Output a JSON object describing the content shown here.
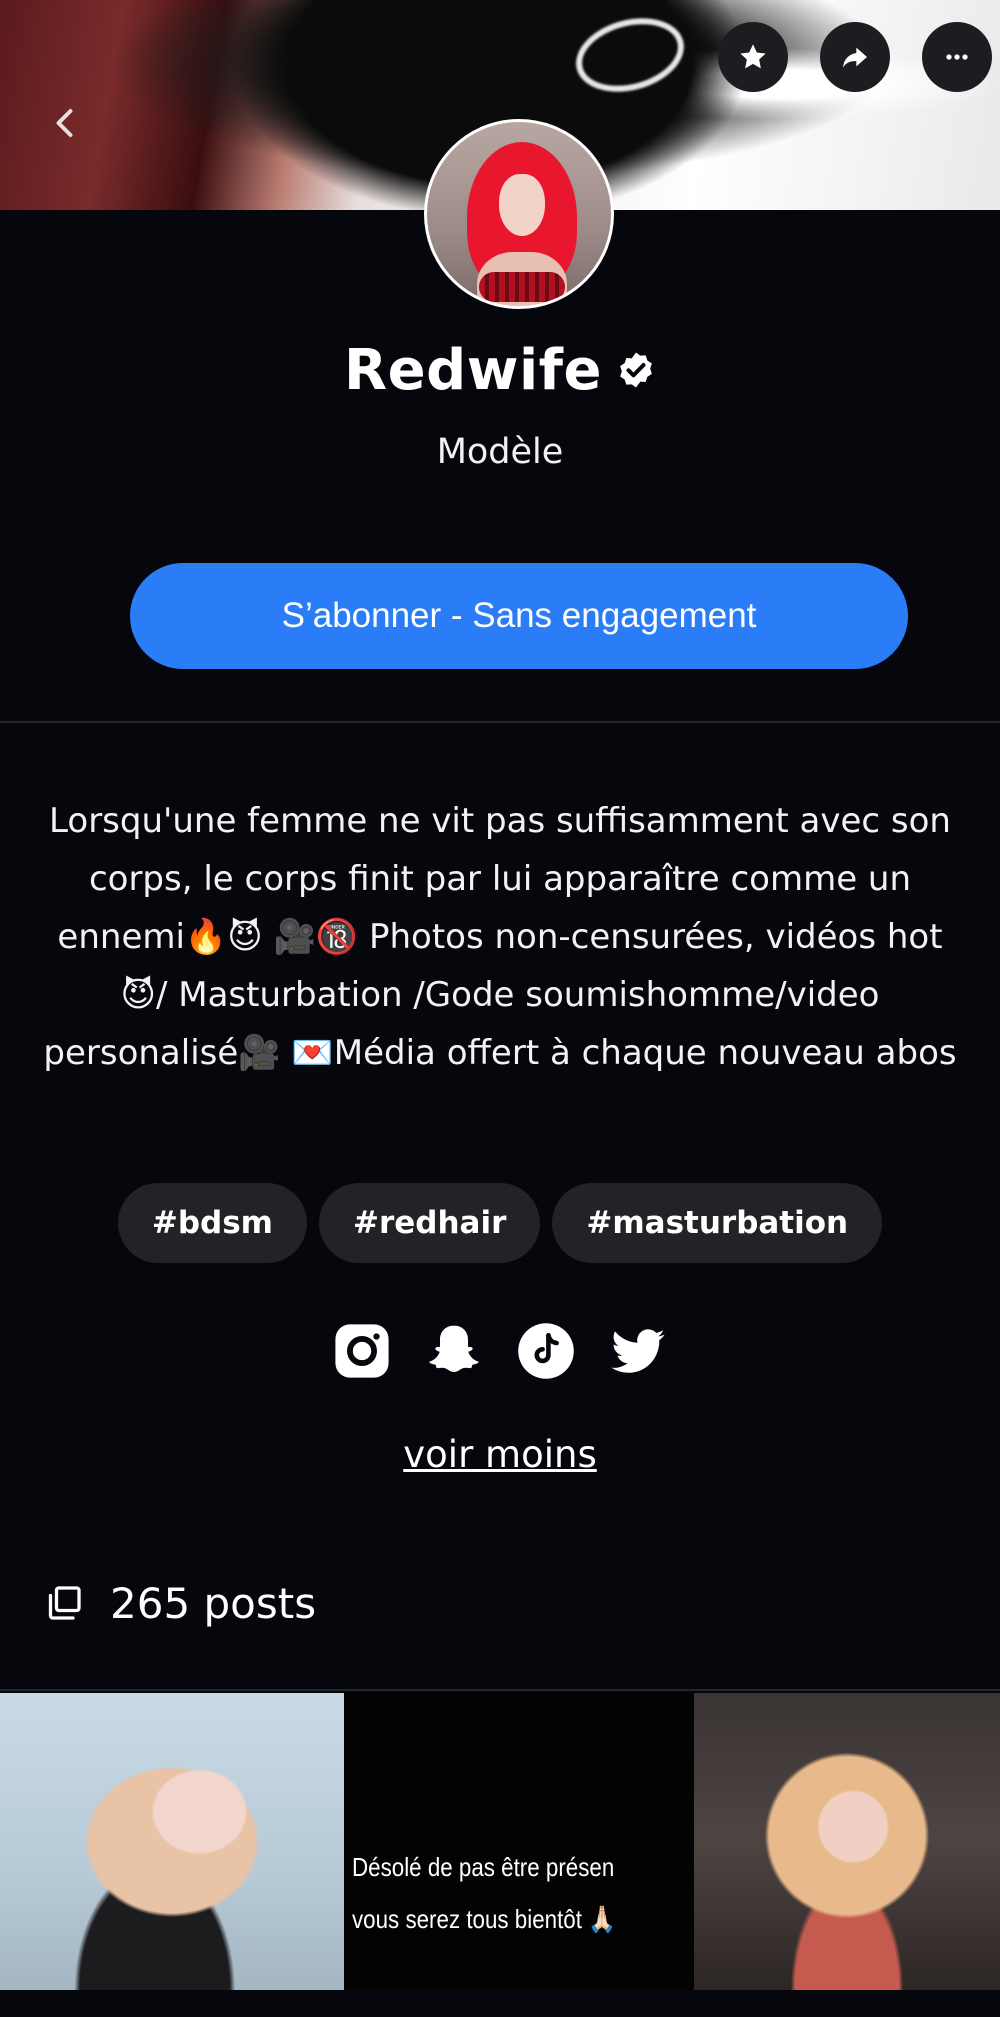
{
  "header": {
    "back_icon": "chevron-left-icon",
    "actions": [
      {
        "icon": "star-icon",
        "label": "favorite"
      },
      {
        "icon": "share-icon",
        "label": "share"
      },
      {
        "icon": "more-icon",
        "label": "more"
      }
    ]
  },
  "profile": {
    "name": "Redwife",
    "verified": true,
    "role": "Modèle",
    "subscribe_label": "S’abonner - Sans engagement",
    "bio": "Lorsqu'une femme ne vit pas suffisamment avec son corps, le corps finit par lui apparaître comme un ennemi🔥😈 🎥🔞 Photos non-censurées, vidéos hot 😈/ Masturbation /Gode soumishomme/video personalisé🎥 💌Média offert à chaque nouveau abos",
    "tags": [
      "#bdsm",
      "#redhair",
      "#masturbation"
    ],
    "socials": [
      "instagram-icon",
      "snapchat-icon",
      "tiktok-icon",
      "twitter-icon"
    ],
    "toggle_label": "voir moins"
  },
  "posts": {
    "count_label": "265 posts",
    "items": [
      {
        "type": "photo"
      },
      {
        "type": "text",
        "caption_line1": "Désolé de pas être présen",
        "caption_line2": "vous serez tous bientôt 🙏🏻"
      },
      {
        "type": "photo"
      }
    ]
  },
  "colors": {
    "background": "#05070d",
    "accent": "#2a7df7",
    "tag_bg": "#222327",
    "button_bg": "#1c1d21"
  }
}
